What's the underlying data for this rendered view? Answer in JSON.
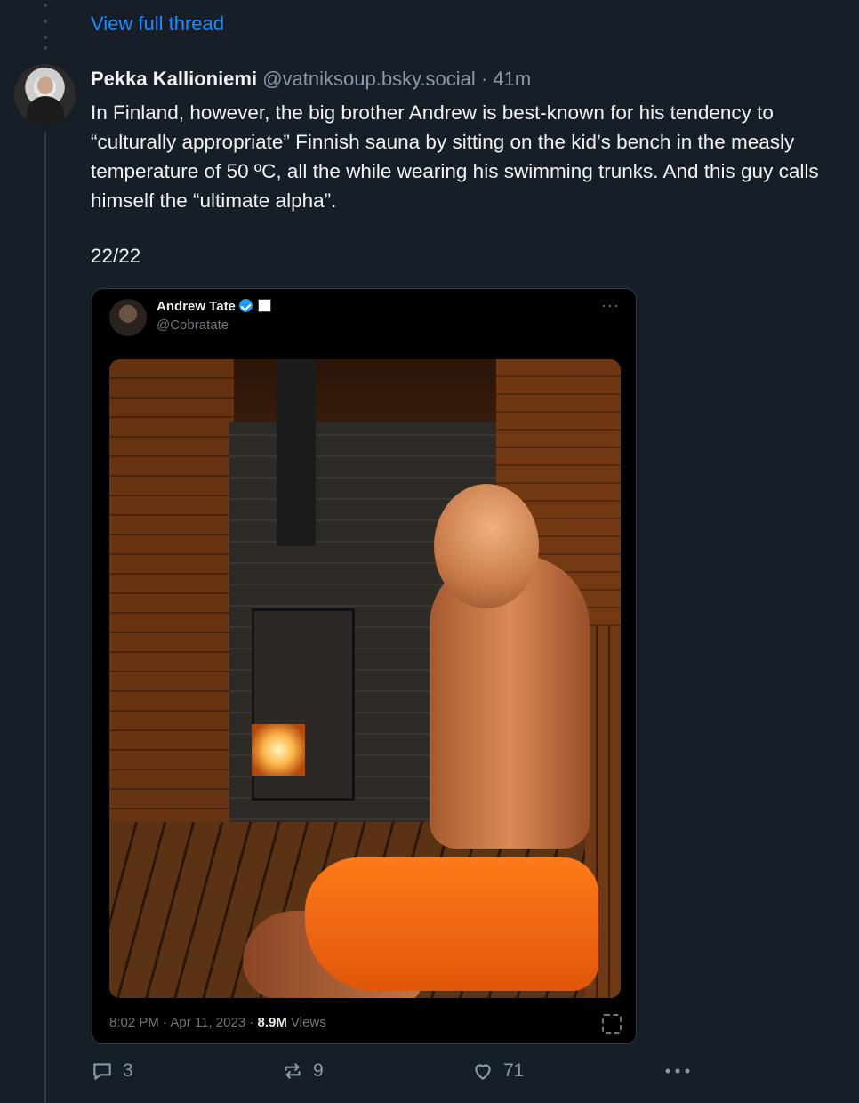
{
  "thread": {
    "view_full_label": "View full thread"
  },
  "post": {
    "author_name": "Pekka Kallioniemi",
    "author_handle": "@vatniksoup.bsky.social",
    "separator": "·",
    "time": "41m",
    "text": "In Finland, however, the big brother Andrew is best-known for his tendency to “culturally appropriate” Finnish sauna by sitting on the kid’s bench in the measly temperature of 50 ºC, all the while wearing his swimming trunks. And this guy calls himself the “ultimate alpha”.",
    "count": "22/22"
  },
  "embed": {
    "author_name": "Andrew Tate",
    "author_handle": "@Cobratate",
    "more_label": "···",
    "timestamp": "8:02 PM · Apr 11, 2023 · ",
    "views_count": "8.9M",
    "views_label": " Views"
  },
  "actions": {
    "replies": "3",
    "reposts": "9",
    "likes": "71"
  },
  "colors": {
    "background": "#161e27",
    "link": "#208bfe",
    "muted": "#8d99a8",
    "verified": "#1d9bf0"
  }
}
